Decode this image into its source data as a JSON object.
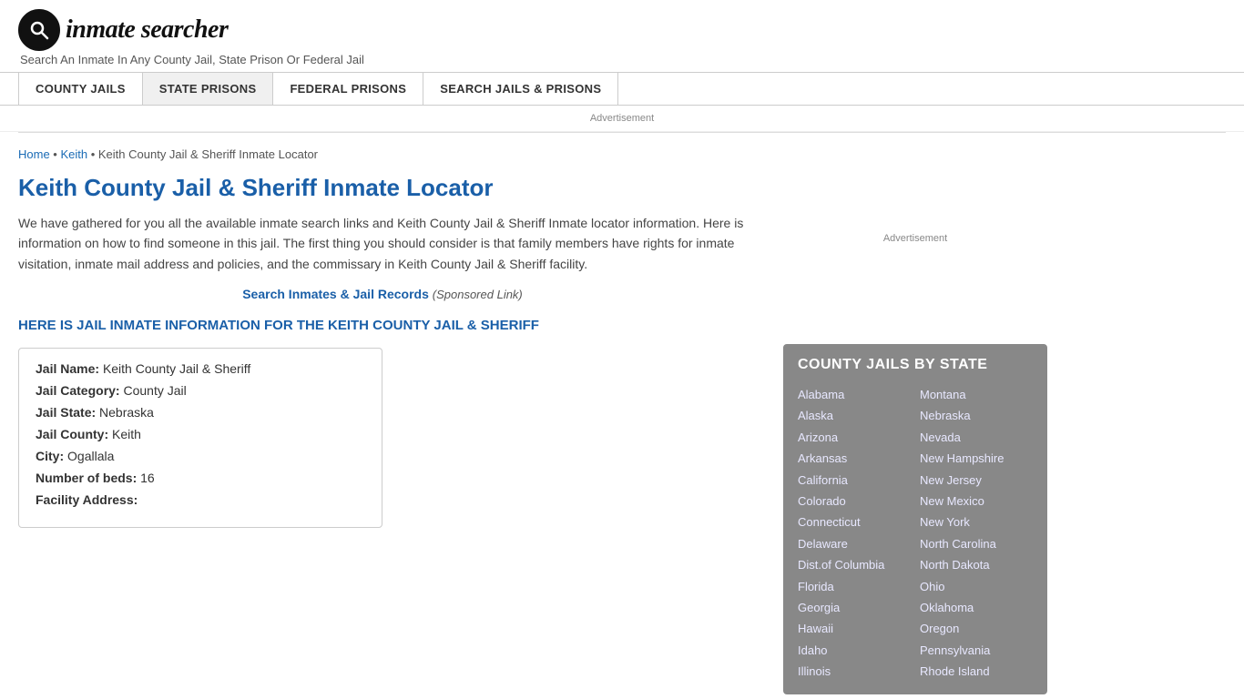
{
  "logo": {
    "icon": "🔍",
    "brand": "inmate searcher",
    "tagline": "Search An Inmate In Any County Jail, State Prison Or Federal Jail"
  },
  "nav": {
    "items": [
      {
        "label": "COUNTY JAILS",
        "id": "county-jails"
      },
      {
        "label": "STATE PRISONS",
        "id": "state-prisons"
      },
      {
        "label": "FEDERAL PRISONS",
        "id": "federal-prisons"
      },
      {
        "label": "SEARCH JAILS & PRISONS",
        "id": "search-jails"
      }
    ]
  },
  "ad_label": "Advertisement",
  "breadcrumb": {
    "home": "Home",
    "parent": "Keith",
    "current": "Keith County Jail & Sheriff Inmate Locator"
  },
  "page_title": "Keith County Jail & Sheriff Inmate Locator",
  "page_desc": "We have gathered for you all the available inmate search links and Keith County Jail & Sheriff Inmate locator information. Here is information on how to find someone in this jail. The first thing you should consider is that family members have rights for inmate visitation, inmate mail address and policies, and the commissary in Keith County Jail & Sheriff facility.",
  "sponsored": {
    "link_text": "Search Inmates & Jail Records",
    "note": "(Sponsored Link)"
  },
  "jail_heading": "HERE IS JAIL INMATE INFORMATION FOR THE KEITH COUNTY JAIL & SHERIFF",
  "jail_info": {
    "name_label": "Jail Name:",
    "name_value": "Keith County Jail & Sheriff",
    "category_label": "Jail Category:",
    "category_value": "County Jail",
    "state_label": "Jail State:",
    "state_value": "Nebraska",
    "county_label": "Jail County:",
    "county_value": "Keith",
    "city_label": "City:",
    "city_value": "Ogallala",
    "beds_label": "Number of beds:",
    "beds_value": "16",
    "address_label": "Facility Address:"
  },
  "sidebar": {
    "ad_label": "Advertisement",
    "county_jails_title": "COUNTY JAILS BY STATE",
    "states_left": [
      "Alabama",
      "Alaska",
      "Arizona",
      "Arkansas",
      "California",
      "Colorado",
      "Connecticut",
      "Delaware",
      "Dist.of Columbia",
      "Florida",
      "Georgia",
      "Hawaii",
      "Idaho",
      "Illinois"
    ],
    "states_right": [
      "Montana",
      "Nebraska",
      "Nevada",
      "New Hampshire",
      "New Jersey",
      "New Mexico",
      "New York",
      "North Carolina",
      "North Dakota",
      "Ohio",
      "Oklahoma",
      "Oregon",
      "Pennsylvania",
      "Rhode Island"
    ]
  }
}
